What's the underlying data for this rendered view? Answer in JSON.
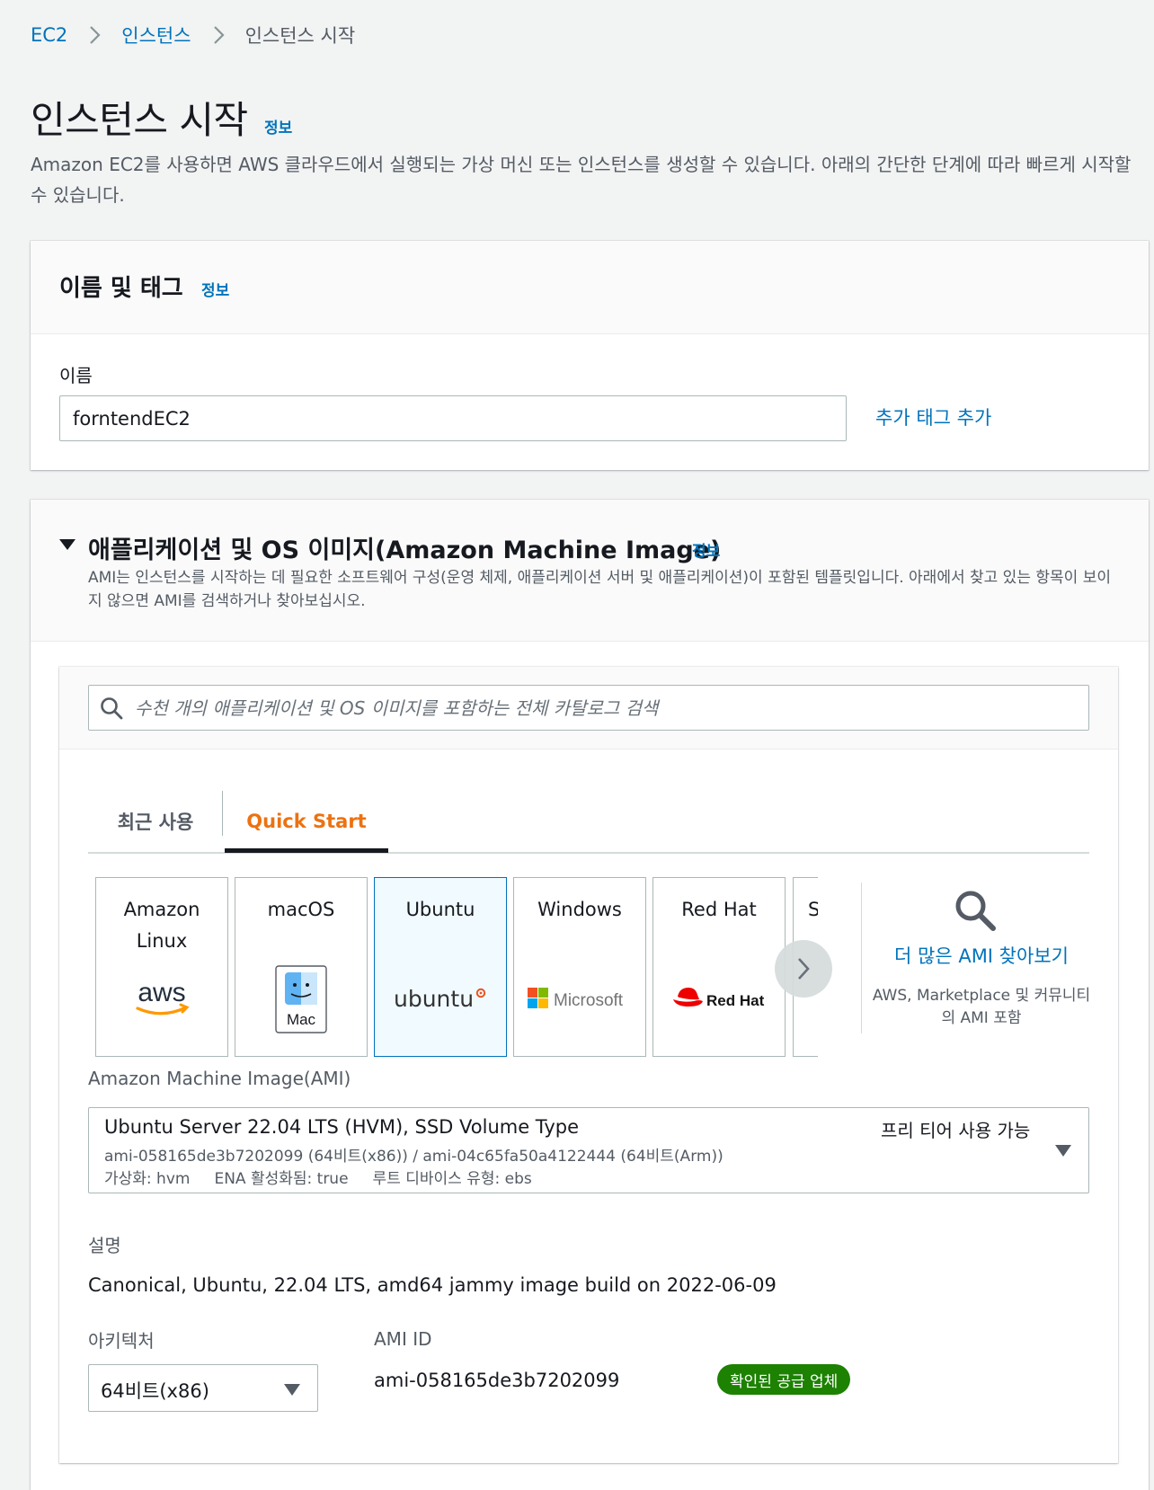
{
  "breadcrumb": [
    "EC2",
    "인스턴스",
    "인스턴스 시작"
  ],
  "page": {
    "title": "인스턴스 시작",
    "info": "정보",
    "description": "Amazon EC2를 사용하면 AWS 클라우드에서 실행되는 가상 머신 또는 인스턴스를 생성할 수 있습니다. 아래의 간단한 단계에 따라 빠르게 시작할 수 있습니다."
  },
  "name_tags": {
    "title": "이름 및 태그",
    "info": "정보",
    "name_label": "이름",
    "name_value": "forntendEC2",
    "add_tag": "추가 태그 추가"
  },
  "ami_section": {
    "title": "애플리케이션 및 OS 이미지(Amazon Machine Image)",
    "info": "정보",
    "description": "AMI는 인스턴스를 시작하는 데 필요한 소프트웨어 구성(운영 체제, 애플리케이션 서버 및 애플리케이션)이 포함된 템플릿입니다. 아래에서 찾고 있는 항목이 보이지 않으면 AMI를 검색하거나 찾아보십시오.",
    "search_placeholder": "수천 개의 애플리케이션 및 OS 이미지를 포함하는 전체 카탈로그 검색",
    "tabs": [
      "최근 사용",
      "Quick Start"
    ],
    "active_tab": "Quick Start",
    "tiles": [
      {
        "label": "Amazon Linux",
        "logo": "aws"
      },
      {
        "label": "macOS",
        "logo": "Mac"
      },
      {
        "label": "Ubuntu",
        "logo": "ubuntu",
        "selected": true
      },
      {
        "label": "Windows",
        "logo": "Microsoft"
      },
      {
        "label": "Red Hat",
        "logo": "Red Hat"
      },
      {
        "label": "S",
        "logo": ""
      }
    ],
    "more_ami_link": "더 많은 AMI 찾아보기",
    "more_ami_sub": "AWS, Marketplace 및 커뮤니티의 AMI 포함",
    "ami_label": "Amazon Machine Image(AMI)",
    "selected_ami": {
      "name": "Ubuntu Server 22.04 LTS (HVM), SSD Volume Type",
      "free_tier": "프리 티어 사용 가능",
      "ids": "ami-058165de3b7202099 (64비트(x86)) / ami-04c65fa50a4122444 (64비트(Arm))",
      "meta": "가상화: hvm     ENA 활성화됨: true     루트 디바이스 유형: ebs"
    },
    "description_label": "설명",
    "description_value": "Canonical, Ubuntu, 22.04 LTS, amd64 jammy image build on 2022-06-09",
    "arch_label": "아키텍처",
    "arch_value": "64비트(x86)",
    "ami_id_label": "AMI ID",
    "ami_id_value": "ami-058165de3b7202099",
    "verified_badge": "확인된 공급 업체"
  },
  "colors": {
    "link": "#0073bb",
    "accent_tab": "#ec7211",
    "badge": "#1d8102",
    "page_bg": "#f2f3f3"
  }
}
